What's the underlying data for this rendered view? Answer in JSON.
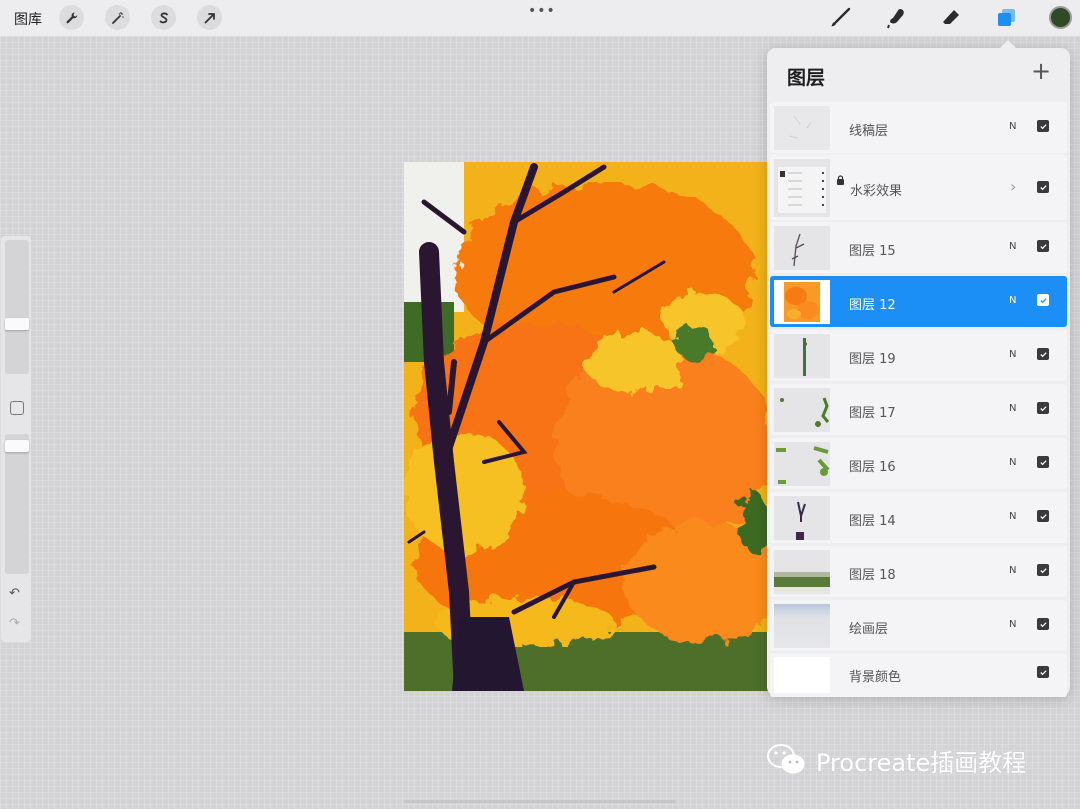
{
  "topbar": {
    "gallery_label": "图库",
    "more": "•••",
    "left_tools": [
      "wrench-icon",
      "magic-wand-icon",
      "selection-icon",
      "transform-arrow-icon"
    ],
    "right_tools": [
      "brush-icon",
      "smudge-icon",
      "eraser-icon",
      "layers-icon"
    ],
    "current_color": "#2f4a24"
  },
  "sidebar": {
    "undo": "↶",
    "redo": "↷"
  },
  "layers_panel": {
    "title": "图层",
    "add_label": "+",
    "accent_color": "#1c8ff7",
    "layers": [
      {
        "name": "线稿层",
        "blend": "N",
        "visible": true,
        "active": false
      },
      {
        "name": "水彩效果",
        "blend": "",
        "visible": true,
        "active": false,
        "locked": true,
        "group": true
      },
      {
        "name": "图层 15",
        "blend": "N",
        "visible": true,
        "active": false
      },
      {
        "name": "图层 12",
        "blend": "N",
        "visible": true,
        "active": true
      },
      {
        "name": "图层 19",
        "blend": "N",
        "visible": true,
        "active": false
      },
      {
        "name": "图层 17",
        "blend": "N",
        "visible": true,
        "active": false
      },
      {
        "name": "图层 16",
        "blend": "N",
        "visible": true,
        "active": false
      },
      {
        "name": "图层 14",
        "blend": "N",
        "visible": true,
        "active": false
      },
      {
        "name": "图层 18",
        "blend": "N",
        "visible": true,
        "active": false
      },
      {
        "name": "绘画层",
        "blend": "N",
        "visible": true,
        "active": false
      },
      {
        "name": "背景颜色",
        "blend": "",
        "visible": true,
        "active": false
      }
    ]
  },
  "watermark": {
    "text": "Procreate插画教程"
  }
}
